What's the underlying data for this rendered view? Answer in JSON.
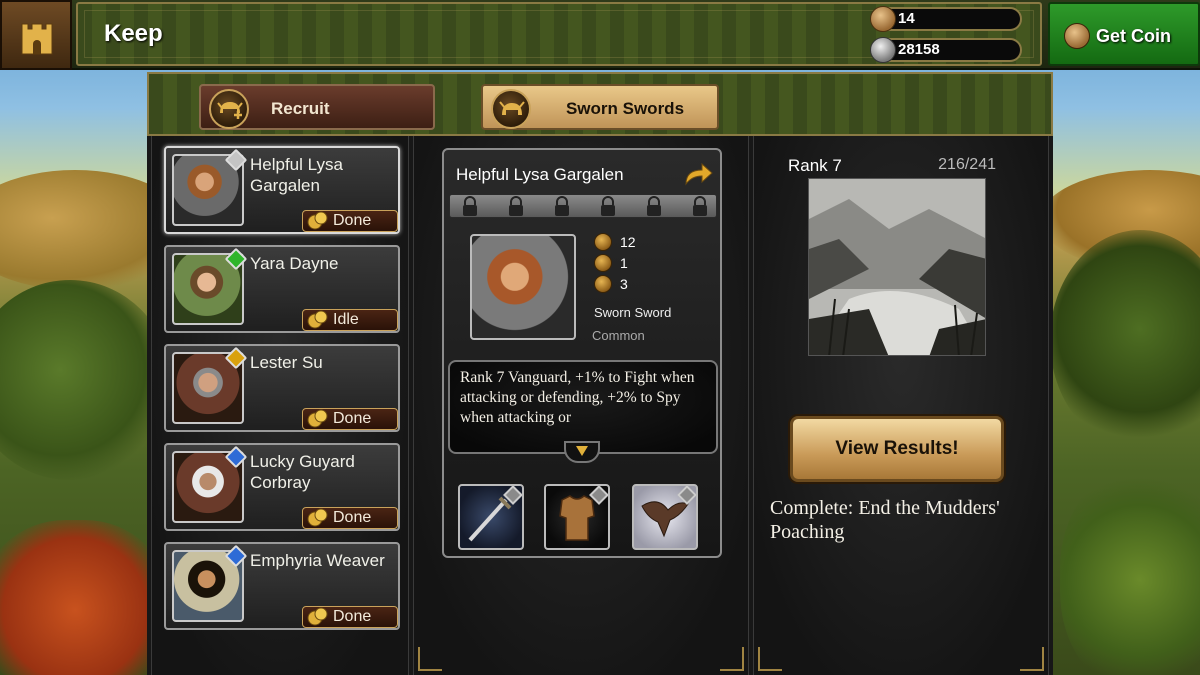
{
  "header": {
    "title": "Keep",
    "resources": [
      {
        "icon": "silver-coin-icon",
        "value": "14"
      },
      {
        "icon": "silver-stone-icon",
        "value": "28158"
      }
    ],
    "get_coin_label": "Get Coin"
  },
  "tabs": [
    {
      "label": "Recruit",
      "icon": "helmet-plus-icon",
      "active": false
    },
    {
      "label": "Sworn Swords",
      "icon": "helmet-icon",
      "active": true
    }
  ],
  "roster": [
    {
      "name": "Helpful Lysa Gargalen",
      "status": "Done",
      "gem_color": "#c4c4c4",
      "selected": true
    },
    {
      "name": "Yara Dayne",
      "status": "Idle",
      "gem_color": "#2fb52a",
      "selected": false
    },
    {
      "name": "Lester Su",
      "status": "Done",
      "gem_color": "#d9a10e",
      "selected": false
    },
    {
      "name": "Lucky Guyard Corbray",
      "status": "Done",
      "gem_color": "#2e6bd6",
      "selected": false
    },
    {
      "name": "Emphyria Weaver",
      "status": "Done",
      "gem_color": "#2e6bd6",
      "selected": false
    }
  ],
  "detail": {
    "name": "Helpful Lysa Gargalen",
    "locks": 6,
    "stats": [
      {
        "icon": "sword-icon",
        "value": "12"
      },
      {
        "icon": "pouch-icon",
        "value": "1"
      },
      {
        "icon": "spider-icon",
        "value": "3"
      }
    ],
    "unit_type": "Sworn Sword",
    "rarity": "Common",
    "description": "Rank 7 Vanguard, +1% to Fight when attacking or defending, +2% to Spy when attacking or",
    "equipment": [
      {
        "icon": "sword-item-icon"
      },
      {
        "icon": "armor-item-icon"
      },
      {
        "icon": "hawk-item-icon"
      }
    ]
  },
  "mission": {
    "rank": "Rank 7",
    "progress": "216/241",
    "button_label": "View Results!",
    "complete_text": "Complete: End the Mudders' Poaching"
  },
  "colors": {
    "accent_gold": "#c9a25a",
    "get_coin_green": "#2e9a2a",
    "panel_dark": "#171717"
  }
}
